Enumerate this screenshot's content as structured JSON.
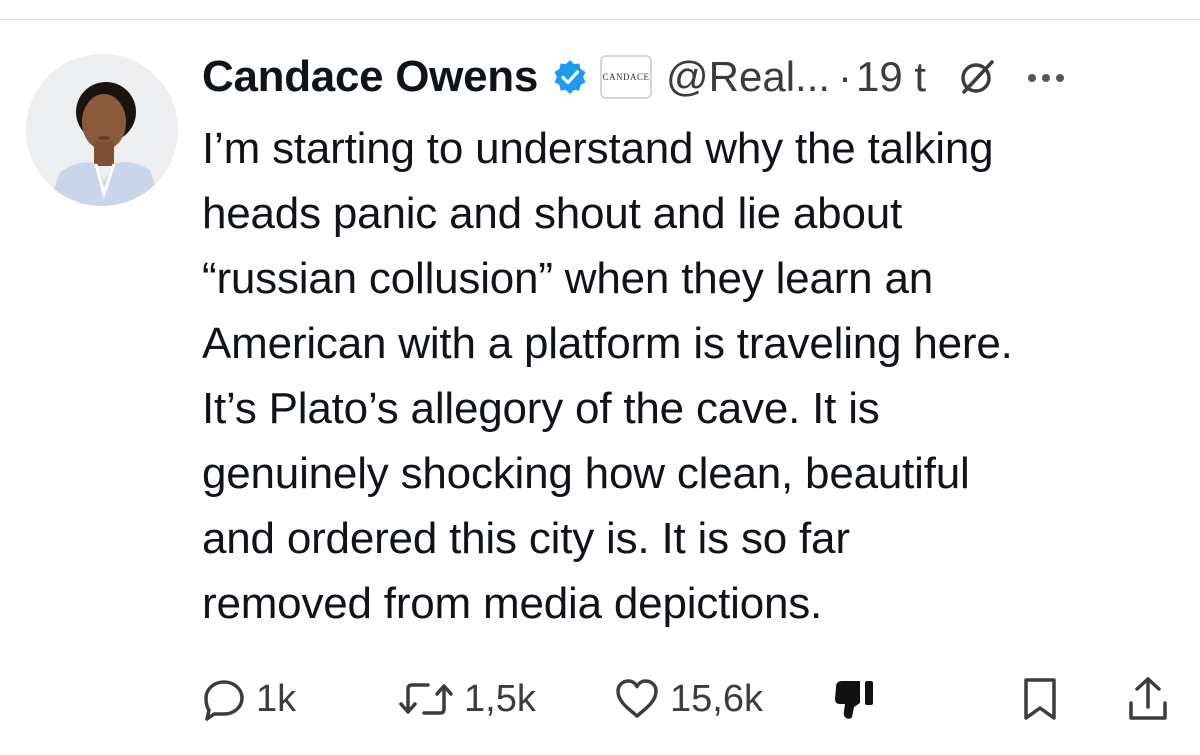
{
  "tweet": {
    "author_name": "Candace Owens",
    "affiliate_badge": "CANDACE",
    "handle": "@Real...",
    "separator": "·",
    "time": "19 t",
    "text": "I’m starting to understand why the talking\nheads panic and shout and lie about\n“russian collusion” when they learn an\nAmerican with a platform is traveling here.\nIt’s Plato’s allegory of the cave. It is\ngenuinely shocking how clean, beautiful\nand ordered this city is. It is so far\nremoved from media depictions."
  },
  "actions": {
    "replies": "1k",
    "reposts": "1,5k",
    "likes": "15,6k"
  },
  "icons": {
    "verified": "verified-badge-icon",
    "grok": "grok-icon",
    "more": "more-icon",
    "reply": "reply-icon",
    "repost": "repost-icon",
    "like": "heart-icon",
    "dislike": "thumbs-down-icon",
    "bookmark": "bookmark-icon",
    "share": "share-icon"
  },
  "colors": {
    "verified_blue": "#1d9bf0",
    "text": "#0f1419",
    "secondary_text": "#3c3c3c"
  }
}
